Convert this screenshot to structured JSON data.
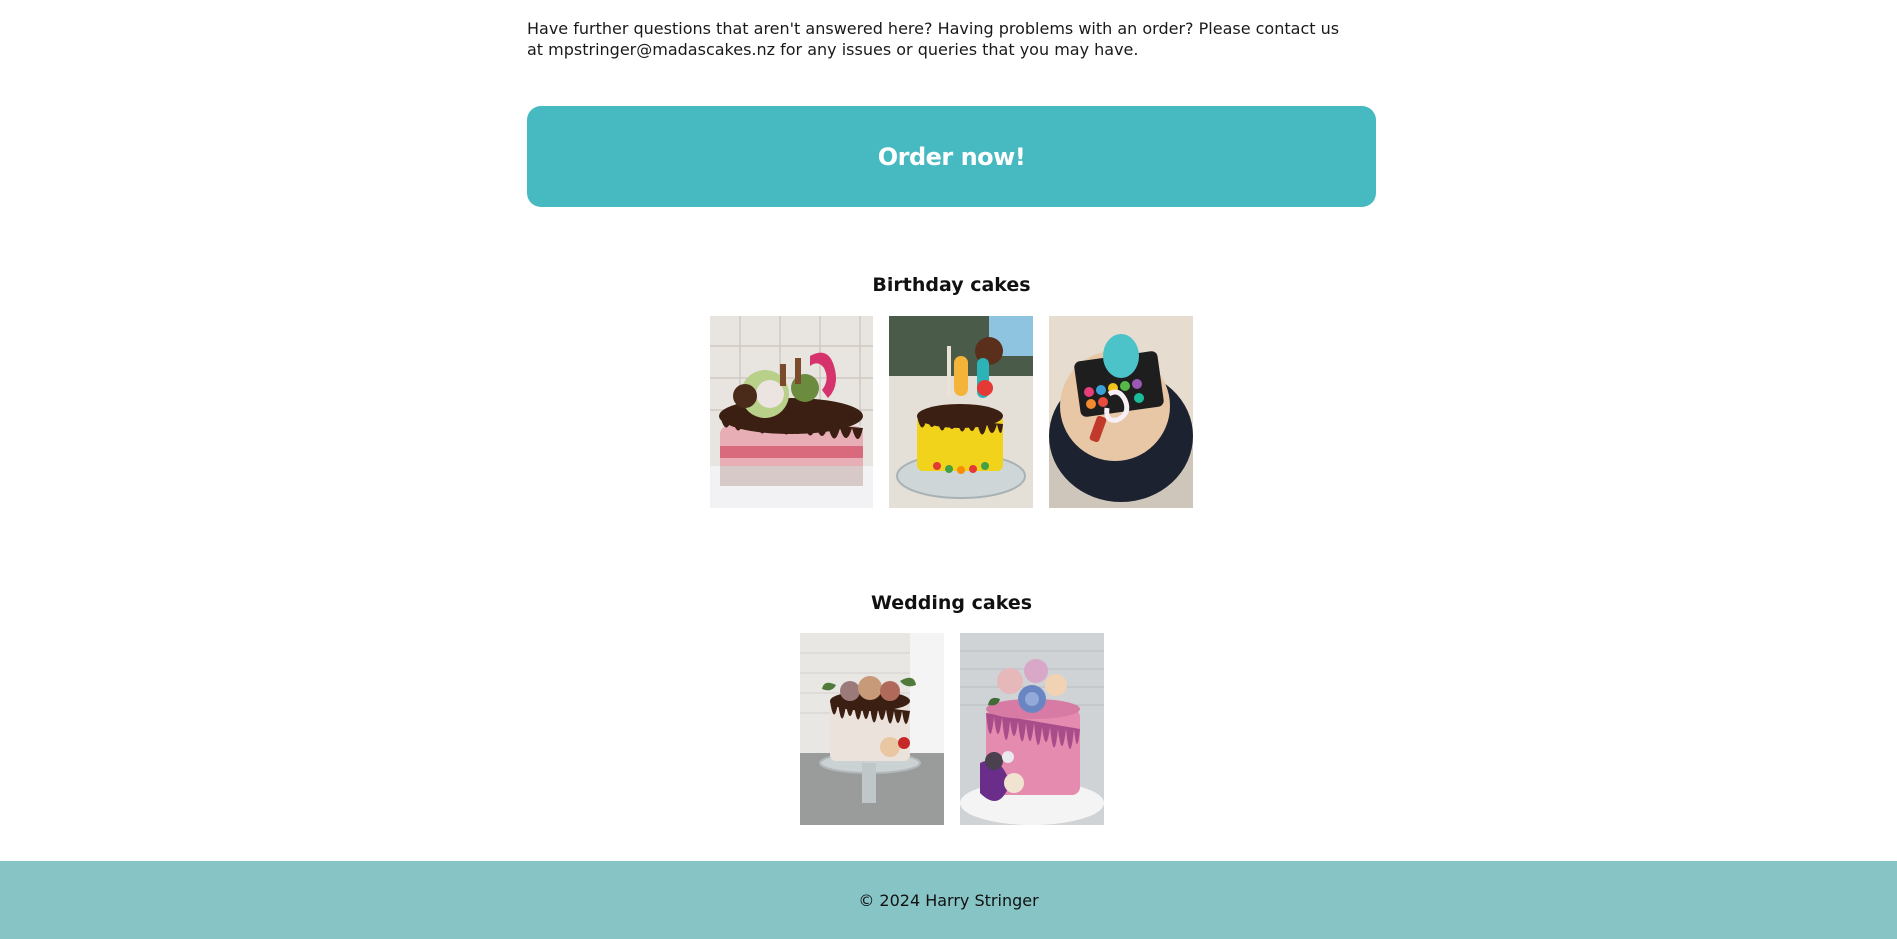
{
  "contact": {
    "text": "Have further questions that aren't answered here? Having problems with an order? Please contact us at mpstringer@madascakes.nz for any issues or queries that you may have."
  },
  "order_button": {
    "label": "Order now!",
    "color": "#47b9c1"
  },
  "birthday": {
    "title": "Birthday cakes",
    "photos": [
      {
        "name": "birthday-cake-photo-1",
        "alt": "Chocolate drip cake with pink layers and 70 topper"
      },
      {
        "name": "birthday-cake-photo-2",
        "alt": "Yellow cake with chocolate drip and lollipops"
      },
      {
        "name": "birthday-cake-photo-3",
        "alt": "Makeup palette themed cake"
      }
    ]
  },
  "wedding": {
    "title": "Wedding cakes",
    "photos": [
      {
        "name": "wedding-cake-photo-1",
        "alt": "Semi-naked cake with chocolate drip and flowers"
      },
      {
        "name": "wedding-cake-photo-2",
        "alt": "Pink drip cake with blue and purple flowers"
      }
    ]
  },
  "footer": {
    "text": "© 2024 Harry Stringer",
    "color": "#87c4c6"
  }
}
